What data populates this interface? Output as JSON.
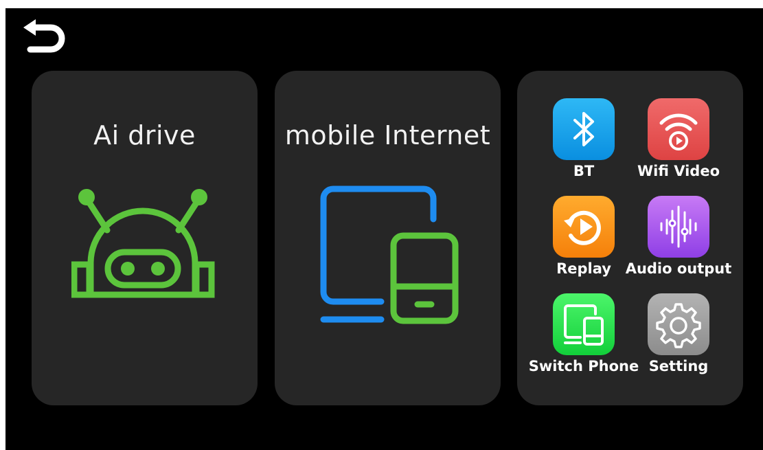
{
  "header": {
    "back_icon": "back-arrow-icon"
  },
  "cards": {
    "ai_drive": {
      "title": "Ai drive",
      "icon": "robot-icon",
      "icon_color": "#5cc43c"
    },
    "mobile_internet": {
      "title": "mobile Internet",
      "icon": "devices-icon",
      "icon_colors": [
        "#1e8cf0",
        "#5cc43c"
      ]
    }
  },
  "apps": [
    {
      "label": "BT",
      "icon": "bluetooth-icon",
      "color": "#1aa3ee"
    },
    {
      "label": "Wifi Video",
      "icon": "wifi-video-icon",
      "color": "#e85454"
    },
    {
      "label": "Replay",
      "icon": "replay-icon",
      "color": "#f7931a"
    },
    {
      "label": "Audio output",
      "icon": "equalizer-icon",
      "color": "#a755ed"
    },
    {
      "label": "Switch Phone",
      "icon": "switch-phone-icon",
      "color": "#2fe04f"
    },
    {
      "label": "Setting",
      "icon": "gear-icon",
      "color": "#9e9e9e"
    }
  ],
  "colors": {
    "background": "#000000",
    "card": "#262626",
    "text": "#ffffff"
  }
}
